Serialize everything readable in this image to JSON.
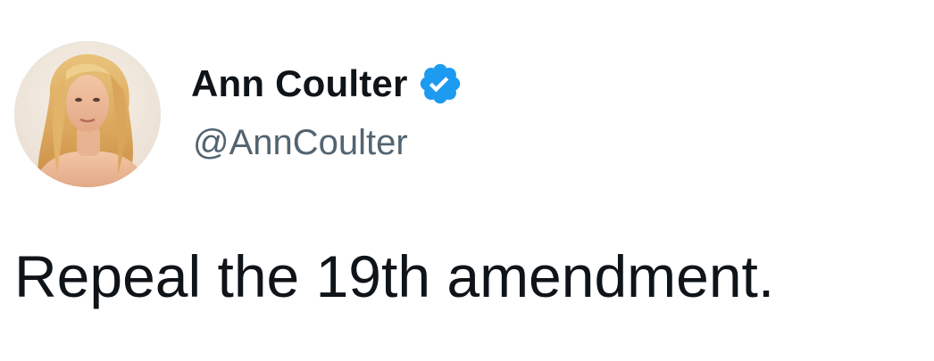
{
  "tweet": {
    "author": {
      "display_name": "Ann Coulter",
      "handle": "@AnnCoulter",
      "verified": true,
      "verified_icon": "verified-badge-icon",
      "verified_color": "#1d9bf0"
    },
    "text": "Repeal the 19th amendment."
  },
  "colors": {
    "name": "#0f1419",
    "handle": "#536471",
    "text": "#0f1419",
    "background": "#ffffff"
  }
}
